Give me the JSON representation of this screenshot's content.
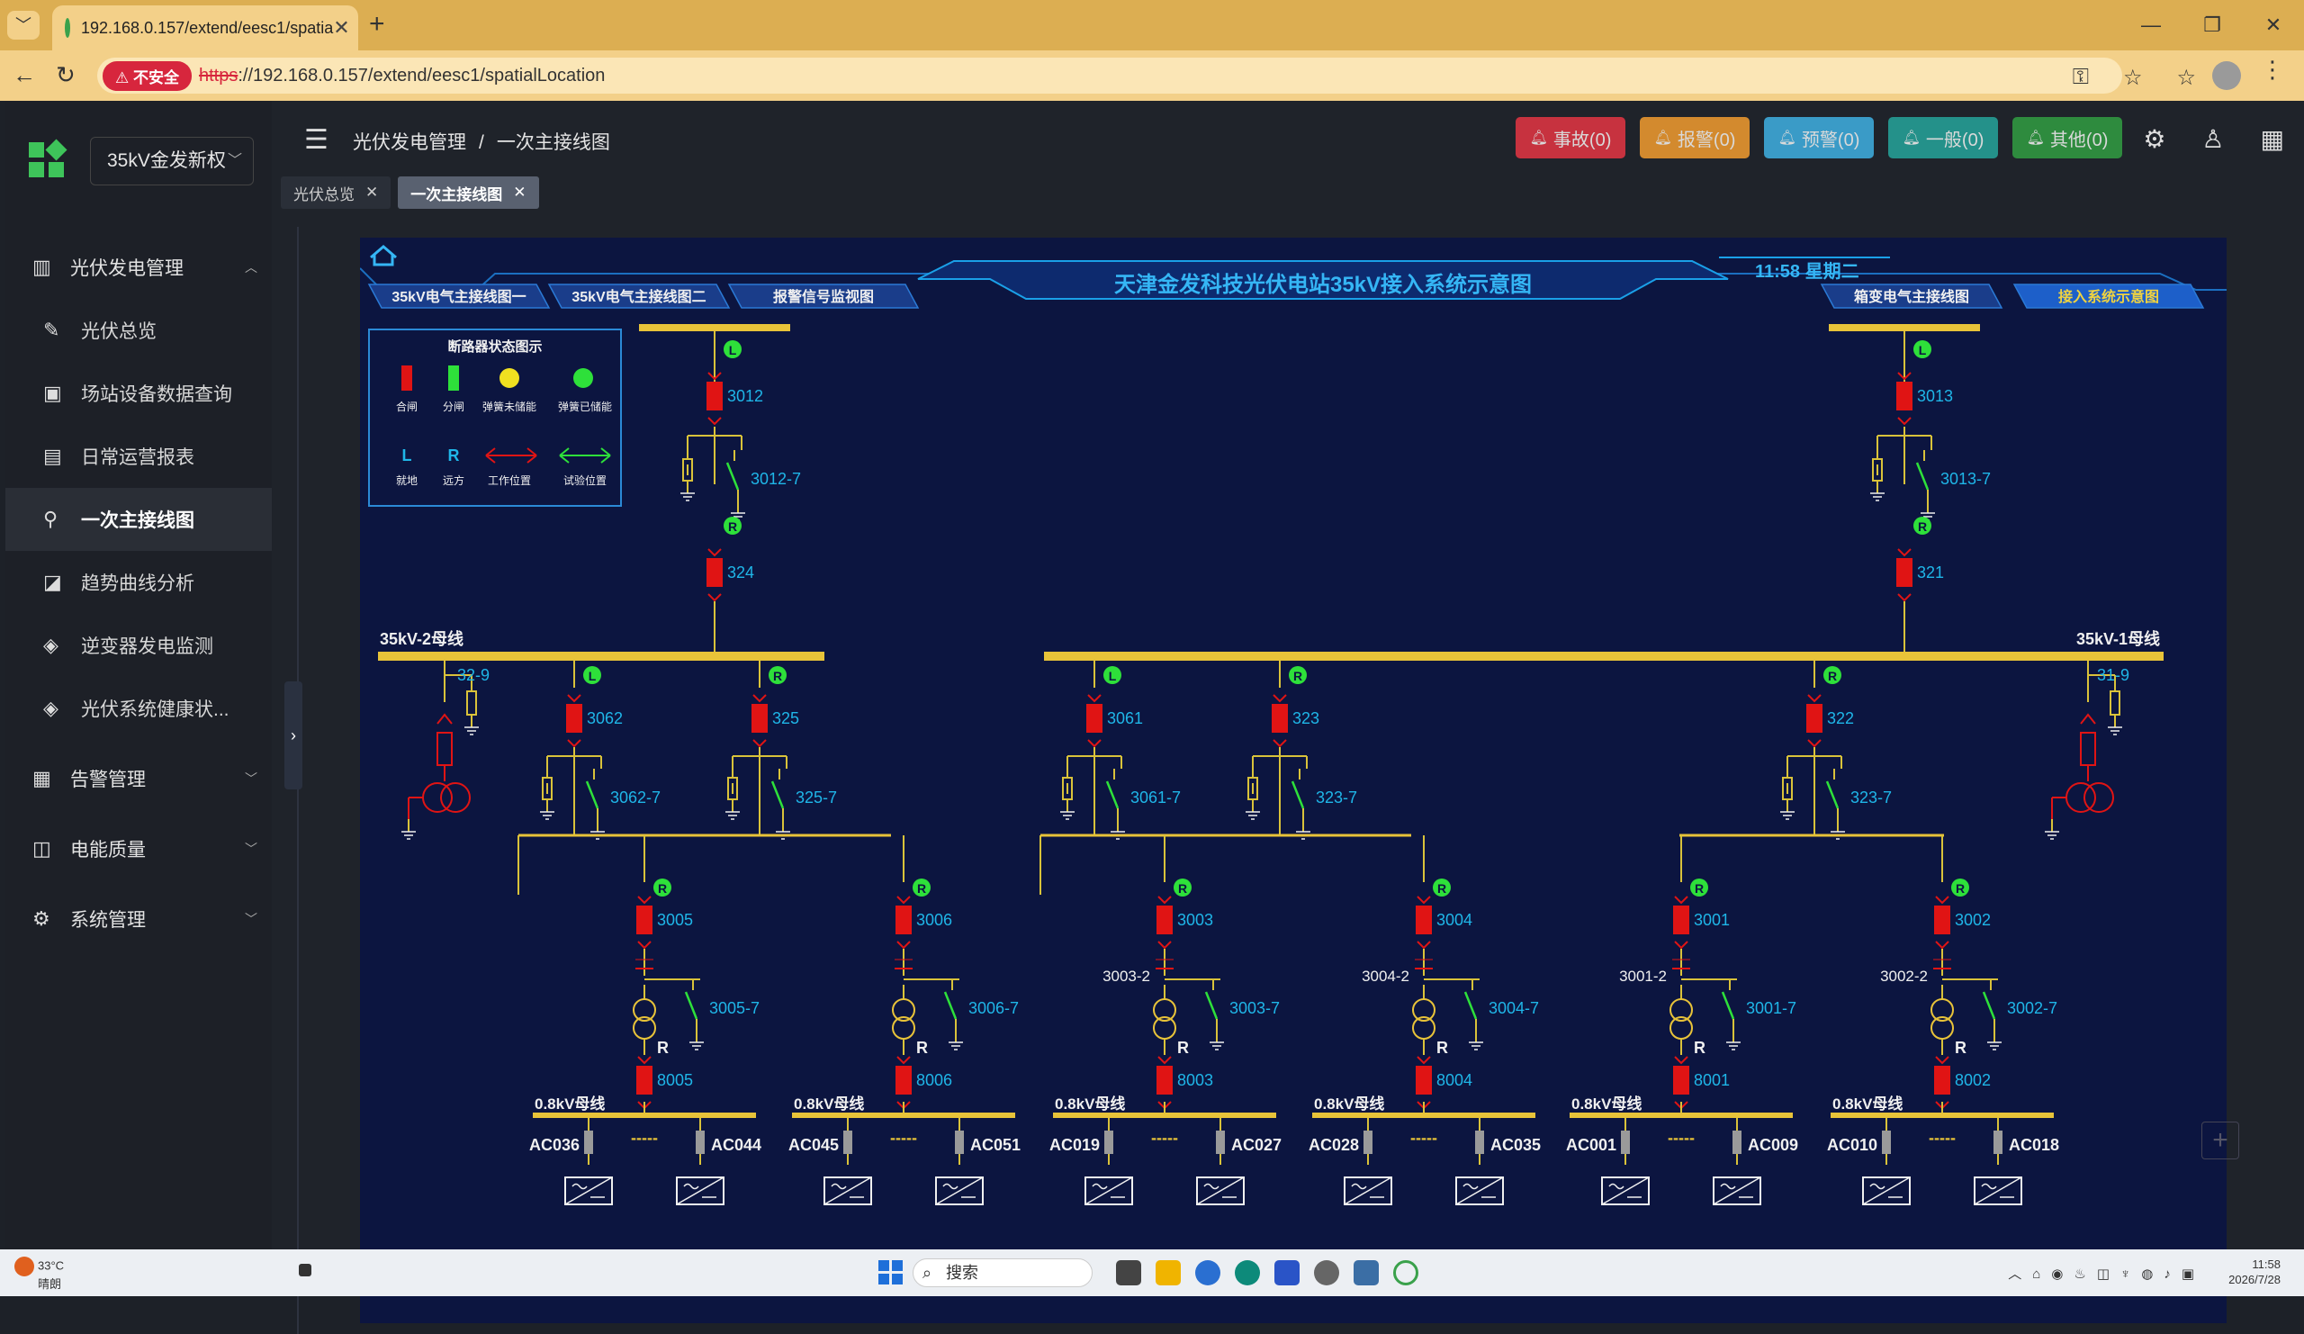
{
  "browser": {
    "tab_title": "192.168.0.157/extend/eesc1/spatia",
    "new_tab": "+",
    "security_label": "不安全",
    "url_scheme": "https",
    "url_rest": "://192.168.0.157/extend/eesc1/spatialLocation"
  },
  "app": {
    "site_select": "35kV金发新权",
    "menu": [
      {
        "label": "光伏发电管理",
        "icon": "chart-icon",
        "type": "top",
        "chev": "︿"
      },
      {
        "label": "光伏总览",
        "icon": "pin-icon",
        "type": "sub"
      },
      {
        "label": "场站设备数据查询",
        "icon": "monitor-icon",
        "type": "sub"
      },
      {
        "label": "日常运营报表",
        "icon": "document-icon",
        "type": "sub"
      },
      {
        "label": "一次主接线图",
        "icon": "location-icon",
        "type": "sub",
        "active": true
      },
      {
        "label": "趋势曲线分析",
        "icon": "trend-icon",
        "type": "sub"
      },
      {
        "label": "逆变器发电监测",
        "icon": "cube-icon",
        "type": "sub"
      },
      {
        "label": "光伏系统健康状...",
        "icon": "cube-icon",
        "type": "sub"
      },
      {
        "label": "告警管理",
        "icon": "clipboard-icon",
        "type": "top",
        "chev": "﹀"
      },
      {
        "label": "电能质量",
        "icon": "pulse-icon",
        "type": "top",
        "chev": "﹀"
      },
      {
        "label": "系统管理",
        "icon": "settings-icon",
        "type": "top",
        "chev": "﹀"
      }
    ],
    "breadcrumb": {
      "parent": "光伏发电管理",
      "sep": "/",
      "current": "一次主接线图"
    },
    "alarms": [
      {
        "label": "事故(0)",
        "color": "#c7323f"
      },
      {
        "label": "报警(0)",
        "color": "#d38a2e"
      },
      {
        "label": "预警(0)",
        "color": "#3a9bc7"
      },
      {
        "label": "一般(0)",
        "color": "#24918a"
      },
      {
        "label": "其他(0)",
        "color": "#2e8b3e"
      }
    ],
    "open_tabs": [
      {
        "label": "光伏总览",
        "active": false
      },
      {
        "label": "一次主接线图",
        "active": true
      }
    ]
  },
  "diagram": {
    "title": "天津金发科技光伏电站35kV接入系统示意图",
    "clock": "11:58 星期二",
    "nav_left": [
      "35kV电气主接线图一",
      "35kV电气主接线图二",
      "报警信号监视图"
    ],
    "nav_right": [
      "箱变电气主接线图",
      "接入系统示意图"
    ],
    "legend": {
      "title": "断路器状态图示",
      "row1": [
        "合闸",
        "分闸",
        "弹簧未储能",
        "弹簧已储能"
      ],
      "row2_letters": [
        "L",
        "R"
      ],
      "row2": [
        "就地",
        "远方",
        "工作位置",
        "试验位置"
      ]
    },
    "bus_left": "35kV-2母线",
    "bus_right": "35kV-1母线",
    "incomers": [
      {
        "breaker": "3012",
        "switch": "3012-7",
        "lower": "324",
        "top_state": "L",
        "mid_state": "R"
      },
      {
        "breaker": "3013",
        "switch": "3013-7",
        "lower": "321",
        "top_state": "L",
        "mid_state": "R"
      }
    ],
    "pt_left": "32-9",
    "pt_right": "31-9",
    "feeders": [
      {
        "breaker": "3062",
        "switch": "3062-7",
        "state": "L"
      },
      {
        "breaker": "325",
        "switch": "325-7",
        "state": "R"
      },
      {
        "breaker": "3061",
        "switch": "3061-7",
        "state": "L"
      },
      {
        "breaker": "323",
        "switch": "323-7",
        "state": "R"
      },
      {
        "breaker": "322",
        "switch": "323-7",
        "state": "R"
      }
    ],
    "boxes": [
      {
        "br": "3005",
        "sw": "3005-7",
        "iso": "",
        "lv": "8005",
        "bus": "0.8kV母线",
        "ac1": "AC036",
        "ac2": "AC044"
      },
      {
        "br": "3006",
        "sw": "3006-7",
        "iso": "",
        "lv": "8006",
        "bus": "0.8kV母线",
        "ac1": "AC045",
        "ac2": "AC051"
      },
      {
        "br": "3003",
        "sw": "3003-7",
        "iso": "3003-2",
        "lv": "8003",
        "bus": "0.8kV母线",
        "ac1": "AC019",
        "ac2": "AC027"
      },
      {
        "br": "3004",
        "sw": "3004-7",
        "iso": "3004-2",
        "lv": "8004",
        "bus": "0.8kV母线",
        "ac1": "AC028",
        "ac2": "AC035"
      },
      {
        "br": "3001",
        "sw": "3001-7",
        "iso": "3001-2",
        "lv": "8001",
        "bus": "0.8kV母线",
        "ac1": "AC001",
        "ac2": "AC009"
      },
      {
        "br": "3002",
        "sw": "3002-7",
        "iso": "3002-2",
        "lv": "8002",
        "bus": "0.8kV母线",
        "ac1": "AC010",
        "ac2": "AC018"
      }
    ],
    "box_state": "R",
    "lv_state": "R",
    "dash": "-----"
  },
  "taskbar": {
    "temp": "33°C",
    "weather": "晴朗",
    "search": "搜索",
    "time": "11:58",
    "date": "2026/7/28"
  }
}
